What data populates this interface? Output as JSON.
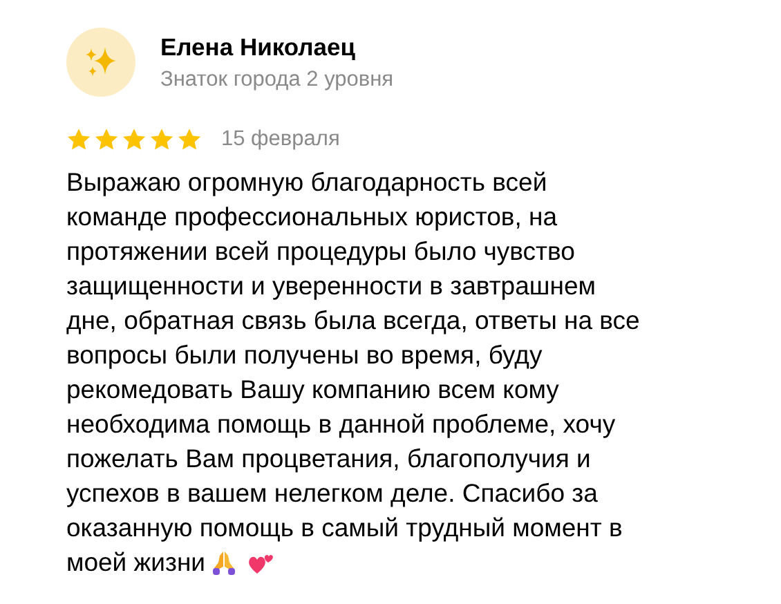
{
  "review": {
    "author": "Елена Николаец",
    "badge": "Знаток города 2 уровня",
    "stars": 5,
    "date": "15 февраля",
    "text_lines": [
      "Выражаю огромную благодарность всей",
      "команде профессиональных юристов, на",
      "протяжении всей процедуры было чувство",
      "защищенности и уверенности в завтрашнем",
      "дне, обратная связь была всегда, ответы на все",
      "вопросы были получены во время, буду",
      "рекомедовать Вашу компанию всем кому",
      "необходима помощь в данной проблеме, хочу",
      "пожелать Вам процветания, благополучия и",
      "успехов в вашем нелегком деле. Спасибо за",
      "оказанную помощь в самый трудный момент в",
      "моей жизни"
    ]
  }
}
